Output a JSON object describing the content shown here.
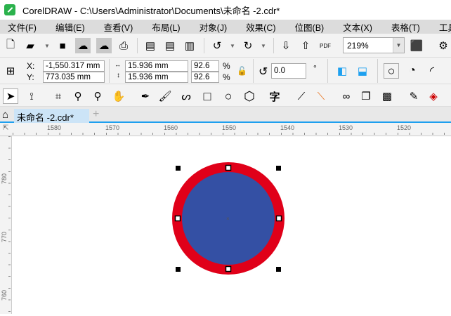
{
  "title": "CorelDRAW - C:\\Users\\Administrator\\Documents\\未命名 -2.cdr*",
  "menu": [
    "文件(F)",
    "编辑(E)",
    "查看(V)",
    "布局(L)",
    "对象(J)",
    "效果(C)",
    "位图(B)",
    "文本(X)",
    "表格(T)",
    "工具(O)"
  ],
  "toolbar": {
    "zoom": "219%",
    "pdf": "PDF"
  },
  "props": {
    "x_label": "X:",
    "y_label": "Y:",
    "x": "-1,550.317 mm",
    "y": "773.035 mm",
    "w": "15.936 mm",
    "h": "15.936 mm",
    "sx": "92.6",
    "sy": "92.6",
    "pct": "%",
    "angle": "0.0",
    "deg": "°"
  },
  "tab": {
    "label": "未命名 -2.cdr*",
    "add": "+"
  },
  "ruler": {
    "h": [
      "1580",
      "1570",
      "1560",
      "1550",
      "1540",
      "1530",
      "1520"
    ],
    "v": [
      "780",
      "770",
      "760"
    ]
  },
  "colors": {
    "outline": "#e00019",
    "fill": "#3450a4",
    "accent": "#1ea0ef"
  }
}
